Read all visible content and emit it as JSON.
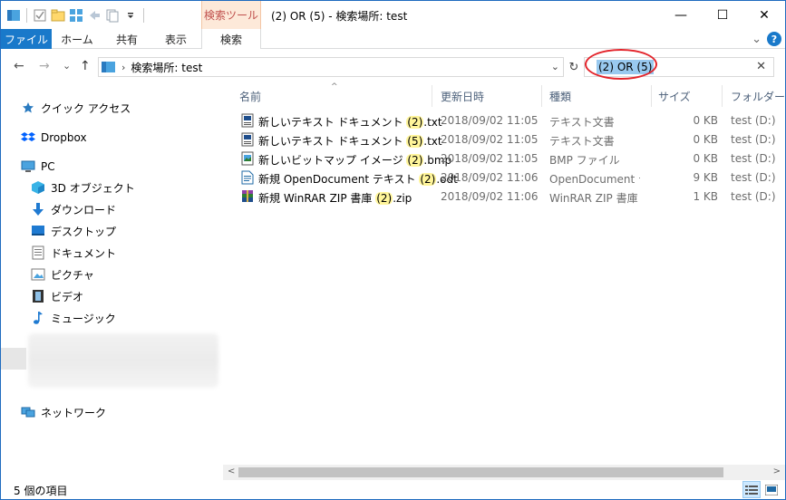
{
  "window": {
    "title": "(2) OR (5) - 検索場所: test",
    "context_tab_header": "検索ツール",
    "caption": {
      "minimize": "—",
      "maximize": "☐",
      "close": "✕"
    }
  },
  "ribbon": {
    "tabs": {
      "file": "ファイル",
      "home": "ホーム",
      "share": "共有",
      "view": "表示",
      "search": "検索"
    },
    "expand_glyph": "⌄",
    "help_glyph": "?"
  },
  "address": {
    "breadcrumb": "検索場所: test",
    "nav_back": "←",
    "nav_forward": "→",
    "nav_recent": "⌄",
    "nav_up": "↑",
    "refresh_glyph": "↻",
    "dropdown_glyph": "⌄"
  },
  "search": {
    "value": "(2) OR (5)",
    "clear_glyph": "✕"
  },
  "nav_pane": {
    "quick_access": "クイック アクセス",
    "dropbox": "Dropbox",
    "pc": "PC",
    "items": {
      "objects3d": "3D オブジェクト",
      "downloads": "ダウンロード",
      "desktop": "デスクトップ",
      "documents": "ドキュメント",
      "pictures": "ピクチャ",
      "videos": "ビデオ",
      "music": "ミュージック"
    },
    "network": "ネットワーク"
  },
  "columns": {
    "name": "名前",
    "date": "更新日時",
    "type": "種類",
    "size": "サイズ",
    "folder": "フォルダー"
  },
  "sort_glyph": "^",
  "files": [
    {
      "pre": "新しいテキスト ドキュメント ",
      "hl": "(2)",
      "post": ".txt",
      "date": "2018/09/02 11:05",
      "type": "テキスト文書",
      "size": "0 KB",
      "folder": "test (D:)",
      "icon": "text-doc-icon"
    },
    {
      "pre": "新しいテキスト ドキュメント ",
      "hl": "(5)",
      "post": ".txt",
      "date": "2018/09/02 11:05",
      "type": "テキスト文書",
      "size": "0 KB",
      "folder": "test (D:)",
      "icon": "text-doc-icon"
    },
    {
      "pre": "新しいビットマップ イメージ ",
      "hl": "(2)",
      "post": ".bmp",
      "date": "2018/09/02 11:05",
      "type": "BMP ファイル",
      "size": "0 KB",
      "folder": "test (D:)",
      "icon": "bitmap-icon"
    },
    {
      "pre": "新規 OpenDocument テキスト ",
      "hl": "(2)",
      "post": ".odt",
      "date": "2018/09/02 11:06",
      "type": "OpenDocument テ",
      "size": "9 KB",
      "folder": "test (D:)",
      "icon": "odt-icon"
    },
    {
      "pre": "新規 WinRAR ZIP 書庫 ",
      "hl": "(2)",
      "post": ".zip",
      "date": "2018/09/02 11:06",
      "type": "WinRAR ZIP 書庫",
      "size": "1 KB",
      "folder": "test (D:)",
      "icon": "winrar-icon"
    }
  ],
  "scrollbar": {
    "left_glyph": "<",
    "right_glyph": ">"
  },
  "status": {
    "count": "5 個の項目"
  },
  "colors": {
    "accent": "#1979ca",
    "highlight": "#fff59a",
    "selection": "#99c9ef",
    "annotation": "#e3242b",
    "context_tab": "#c0504d"
  }
}
